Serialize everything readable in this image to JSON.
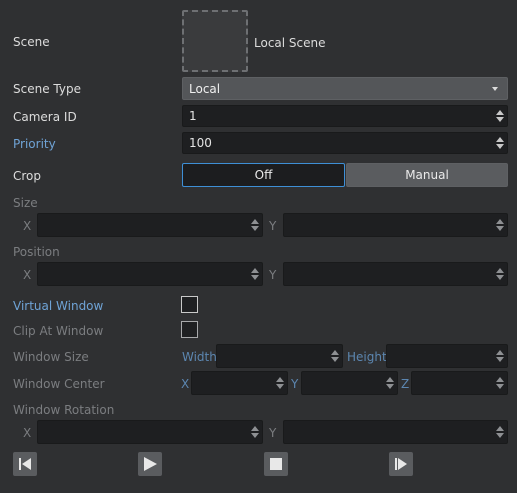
{
  "scene": {
    "label": "Scene",
    "thumbnail_caption": "Local Scene"
  },
  "scene_type": {
    "label": "Scene Type",
    "value": "Local"
  },
  "camera_id": {
    "label": "Camera ID",
    "value": "1"
  },
  "priority": {
    "label": "Priority",
    "value": "100"
  },
  "crop": {
    "label": "Crop",
    "options": [
      "Off",
      "Manual"
    ],
    "selected": "Off"
  },
  "size": {
    "label": "Size",
    "x_label": "X",
    "y_label": "Y",
    "x_value": "",
    "y_value": ""
  },
  "position": {
    "label": "Position",
    "x_label": "X",
    "y_label": "Y",
    "x_value": "",
    "y_value": ""
  },
  "virtual_window": {
    "label": "Virtual Window",
    "checked": false
  },
  "clip_at_window": {
    "label": "Clip At Window",
    "checked": false
  },
  "window_size": {
    "label": "Window Size",
    "width_label": "Width",
    "height_label": "Height"
  },
  "window_center": {
    "label": "Window Center",
    "x_label": "X",
    "y_label": "Y",
    "z_label": "Z"
  },
  "window_rotation": {
    "label": "Window Rotation",
    "x_label": "X",
    "y_label": "Y"
  },
  "playback": {
    "buttons": [
      "skip-to-start-icon",
      "play-icon",
      "stop-icon",
      "step-forward-icon"
    ]
  },
  "colors": {
    "background": "#2f3032",
    "accent_blue": "#3e8fd6",
    "label_blue": "#6fa3d6",
    "disabled_text": "#7b7d80"
  }
}
